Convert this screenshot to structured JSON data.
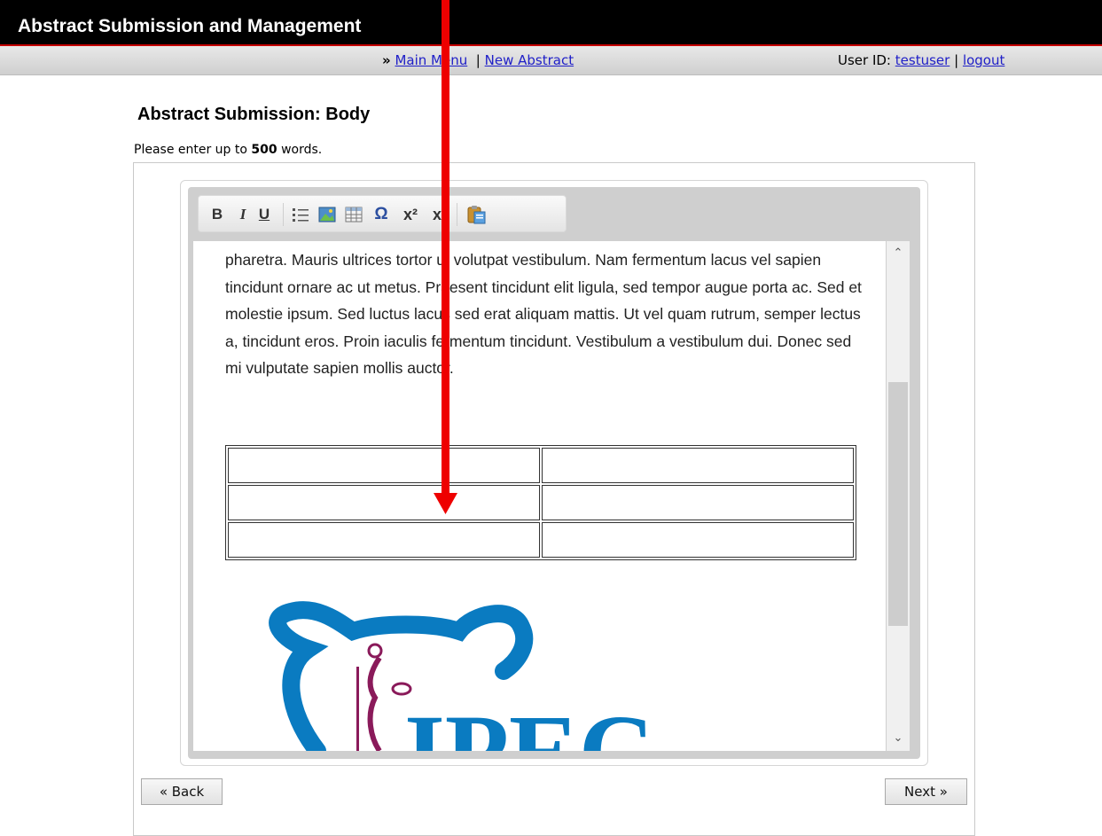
{
  "header": {
    "title": "Abstract Submission and Management"
  },
  "nav": {
    "prefix": "»",
    "main_menu": "Main Menu",
    "separator": "|",
    "new_abstract": "New Abstract",
    "user_label": "User ID:",
    "user_id": "testuser",
    "user_sep": "|",
    "logout": "logout"
  },
  "page": {
    "heading": "Abstract Submission: Body",
    "instruction_pre": "Please enter up to ",
    "instruction_limit": "500",
    "instruction_post": " words."
  },
  "toolbar": {
    "bold": "B",
    "italic": "I",
    "underline": "U",
    "special_char": "Ω",
    "superscript": "x²",
    "subscript": "x₂",
    "icons": [
      "bold-icon",
      "italic-icon",
      "underline-icon",
      "bullet-list-icon",
      "insert-image-icon",
      "insert-table-icon",
      "special-character-icon",
      "superscript-icon",
      "subscript-icon",
      "paste-icon"
    ]
  },
  "editor": {
    "body_text": "pharetra. Mauris ultrices tortor ut volutpat vestibulum. Nam fermentum lacus vel sapien tincidunt ornare ac ut metus. Praesent tincidunt elit ligula, sed tempor augue porta ac. Sed et molestie ipsum. Sed luctus lacus sed erat aliquam mattis. Ut vel quam rutrum, semper lectus a, tincidunt eros. Proin iaculis fermentum tincidunt. Vestibulum a vestibulum dui. Donec sed mi vulputate sapien mollis auctor.",
    "table": {
      "rows": 3,
      "cols": 2
    },
    "logo_text": "IPEC"
  },
  "buttons": {
    "back": "« Back",
    "next": "Next »"
  },
  "colors": {
    "header_bg": "#000000",
    "accent": "#c40000",
    "link": "#2020c8",
    "arrow": "#ee0000",
    "logo_blue": "#0a7bc1",
    "logo_purple": "#8a1a5a"
  }
}
